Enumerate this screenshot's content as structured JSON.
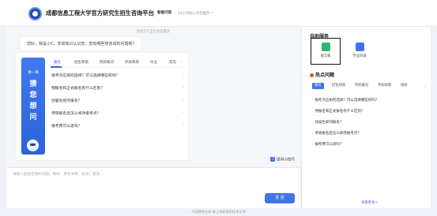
{
  "header": {
    "title": "成都信息工程大学官方研究生招生咨询平台",
    "badge": "智能问答",
    "subtitle": "· 24小时贴心为您服务～"
  },
  "chat": {
    "welcome_notice": "智能小C正在为您服务",
    "greeting": "您好，我是小C，非常高兴认识您，您有哪些想咨询的问题呢?",
    "guess_panel": {
      "top_label": "猜一猜",
      "chars": [
        "猜",
        "您",
        "想",
        "问"
      ]
    },
    "faq_tabs": [
      {
        "label": "报名"
      },
      {
        "label": "招生政策"
      },
      {
        "label": "院校概况"
      },
      {
        "label": "奖助政策"
      },
      {
        "label": "毕业"
      },
      {
        "label": "常见"
      }
    ],
    "faq_questions": [
      "报考点应如何选择？可以选择哪些校吗？",
      "预报名和正式报名有什么区别？",
      "往届生如何报名？",
      "考研报名后怎么修改报考点？",
      "报考费可以退吗？"
    ],
    "tips_label": "提问小技巧",
    "tips_icon": "question-icon"
  },
  "input": {
    "placeholder": "请输入您想咨询的问题。例如：参考书目、初试、复试...",
    "value": "",
    "send_label": "发 送"
  },
  "footer": {
    "text": "中国教育在线 掌上考研提供技术支持"
  },
  "sidebar": {
    "self_service_title": "自助服务",
    "services": [
      {
        "label": "留言板",
        "icon": "message-board-icon",
        "color": "#2eb872"
      },
      {
        "label": "专业目录",
        "icon": "catalog-icon",
        "color": "#3f74e6"
      }
    ],
    "hot_title": "热点问题",
    "hot_tabs": [
      "报名",
      "招生政策",
      "院校概况",
      "奖助政策",
      "接收"
    ],
    "hot_questions": [
      "报考点应如何选择？可以选择哪些校吗？",
      "预报名和正式报名有什么区别？",
      "往届生如何报名？",
      "考研报名后怎么修改报考点？",
      "报考费可以退吗？"
    ],
    "more_label": "查看更多>"
  },
  "colors": {
    "accent": "#3f74e6",
    "hot": "#e4483d",
    "service_green": "#2eb872"
  }
}
